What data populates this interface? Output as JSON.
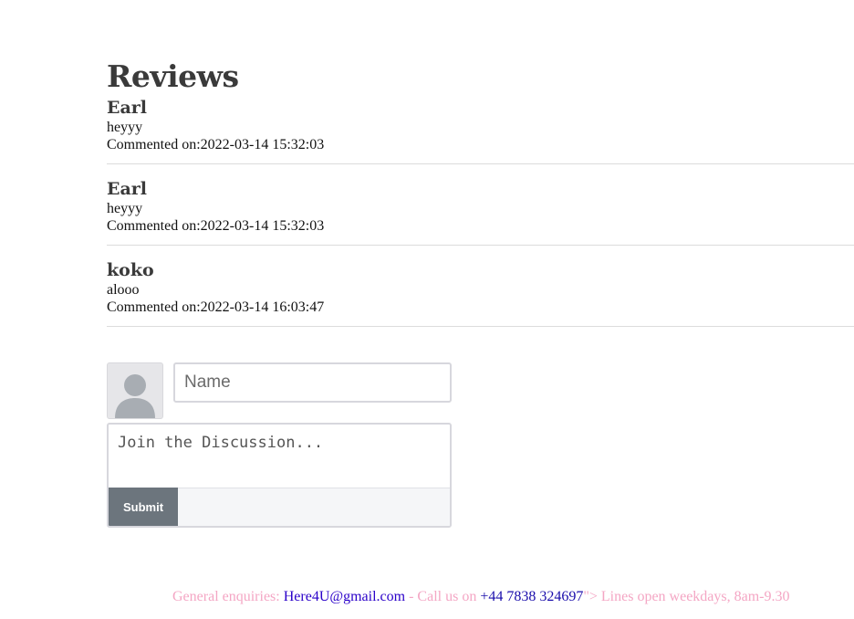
{
  "reviews": {
    "title": "Reviews",
    "items": [
      {
        "author": "Earl",
        "text": "heyyy",
        "date": "Commented on:2022-03-14 15:32:03"
      },
      {
        "author": "Earl",
        "text": "heyyy",
        "date": "Commented on:2022-03-14 15:32:03"
      },
      {
        "author": "koko",
        "text": "alooo",
        "date": "Commented on:2022-03-14 16:03:47"
      }
    ]
  },
  "form": {
    "name_placeholder": "Name",
    "name_value": "",
    "comment_placeholder": "Join the Discussion...",
    "comment_value": "",
    "submit_label": "Submit",
    "avatar_icon": "user-silhouette-icon"
  },
  "footer": {
    "prefix": "General enquiries: ",
    "email": "Here4U@gmail.com",
    "middle": " - Call us on ",
    "phone": "+44 7838 324697",
    "suffix": "\"> Lines open weekdays, 8am-9.30"
  },
  "colors": {
    "submit_bg": "#6c757d",
    "footer_text": "#f4a6c4",
    "link": "#2a00c9"
  }
}
